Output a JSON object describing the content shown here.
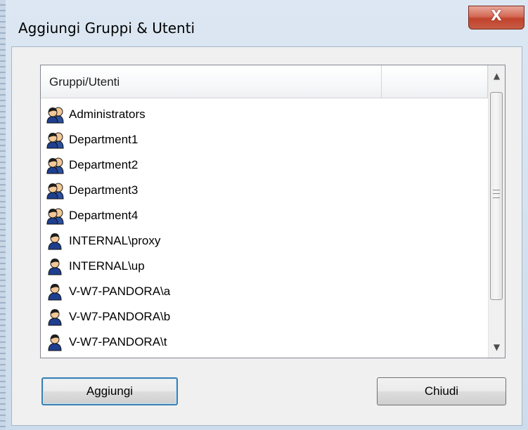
{
  "window": {
    "title": "Aggiungi Gruppi & Utenti",
    "close_glyph": "X"
  },
  "list": {
    "columns": [
      "Gruppi/Utenti",
      ""
    ],
    "items": [
      {
        "label": "Administrators",
        "icon": "group-icon"
      },
      {
        "label": "Department1",
        "icon": "group-icon"
      },
      {
        "label": "Department2",
        "icon": "group-icon"
      },
      {
        "label": "Department3",
        "icon": "group-icon"
      },
      {
        "label": "Department4",
        "icon": "group-icon"
      },
      {
        "label": "INTERNAL\\proxy",
        "icon": "user-icon"
      },
      {
        "label": "INTERNAL\\up",
        "icon": "user-icon"
      },
      {
        "label": "V-W7-PANDORA\\a",
        "icon": "user-icon"
      },
      {
        "label": "V-W7-PANDORA\\b",
        "icon": "user-icon"
      },
      {
        "label": "V-W7-PANDORA\\t",
        "icon": "user-icon"
      }
    ]
  },
  "buttons": {
    "add_label": "Aggiungi",
    "close_label": "Chiudi"
  },
  "colors": {
    "close_button": "#c2432c",
    "focus_border": "#3c7fb1",
    "window_frame": "#cddcec"
  }
}
